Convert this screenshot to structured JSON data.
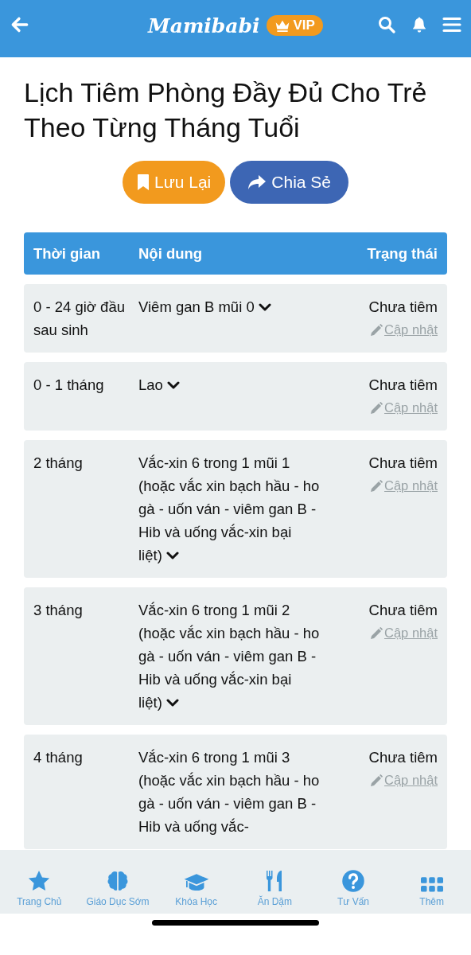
{
  "header": {
    "logo": "Mamibabi",
    "badge": "VIP"
  },
  "title": "Lịch Tiêm Phòng Đầy Đủ Cho Trẻ Theo Từng Tháng Tuổi",
  "actions": [
    {
      "label": "Lưu Lại",
      "kind": "save"
    },
    {
      "label": "Chia Sẻ",
      "kind": "share"
    }
  ],
  "table": {
    "columns": [
      "Thời gian",
      "Nội dung",
      "Trạng thái"
    ],
    "rows": [
      {
        "time": "0 - 24 giờ đầu sau sinh",
        "content": "Viêm gan B mũi 0",
        "status": "Chưa tiêm",
        "action": "Cập nhật"
      },
      {
        "time": "0 - 1 tháng",
        "content": "Lao",
        "status": "Chưa tiêm",
        "action": "Cập nhật"
      },
      {
        "time": "2 tháng",
        "content": "Vắc-xin 6 trong 1 mũi 1 (hoặc vắc xin bạch hầu - ho gà - uốn ván - viêm gan B - Hib và uống vắc-xin bại liệt)",
        "status": "Chưa tiêm",
        "action": "Cập nhật"
      },
      {
        "time": "3 tháng",
        "content": "Vắc-xin 6 trong 1 mũi 2 (hoặc vắc xin bạch hầu - ho gà - uốn ván - viêm gan B - Hib và uống vắc-xin bại liệt)",
        "status": "Chưa tiêm",
        "action": "Cập nhật"
      },
      {
        "time": "4 tháng",
        "content": "Vắc-xin 6 trong 1 mũi 3 (hoặc vắc xin bạch hầu - ho gà - uốn ván - viêm gan B - Hib và uống vắc-",
        "status": "Chưa tiêm",
        "action": "Cập nhật"
      }
    ]
  },
  "bottom_nav": [
    {
      "label": "Trang Chủ"
    },
    {
      "label": "Giáo Dục Sớm"
    },
    {
      "label": "Khóa Học"
    },
    {
      "label": "Ăn Dặm"
    },
    {
      "label": "Tư Vấn"
    },
    {
      "label": "Thêm"
    }
  ]
}
